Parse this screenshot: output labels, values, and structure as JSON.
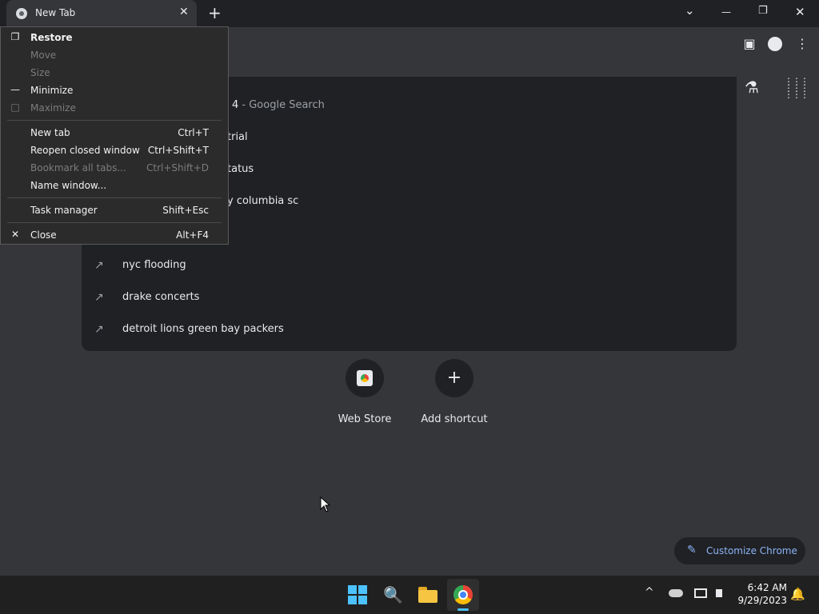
{
  "browser": {
    "tab_title": "New Tab",
    "tab_close": "✕",
    "new_tab": "+",
    "window_buttons": {
      "tab_search": "⌄",
      "minimize": "—",
      "restore": "❐",
      "close": "✕"
    }
  },
  "toolbar": {
    "side_panel": "▣",
    "menu": "⋮"
  },
  "page_icons": {
    "labs": "⚗",
    "apps": "⋮⋮⋮"
  },
  "suggestions": [
    {
      "icon": "trending-icon",
      "visible_text": "4",
      "suffix": " - Google Search"
    },
    {
      "icon": "trending-icon",
      "visible_text": "trial",
      "suffix": ""
    },
    {
      "icon": "trending-icon",
      "visible_text": "tatus",
      "suffix": ""
    },
    {
      "icon": "trending-icon",
      "visible_text": "y columbia sc",
      "suffix": ""
    },
    {
      "icon": "trending-icon",
      "visible_text": "",
      "suffix": ""
    },
    {
      "icon": "trending-icon",
      "visible_text": "nyc flooding",
      "suffix": ""
    },
    {
      "icon": "trending-icon",
      "visible_text": "drake concerts",
      "suffix": ""
    },
    {
      "icon": "trending-icon",
      "visible_text": "detroit lions green bay packers",
      "suffix": ""
    }
  ],
  "trend_glyph": "↗",
  "shortcuts": [
    {
      "label": "Web Store"
    },
    {
      "label": "Add shortcut",
      "glyph": "+"
    }
  ],
  "customize": {
    "label": "Customize Chrome",
    "glyph": "✎"
  },
  "system_menu": {
    "restore": {
      "label": "Restore",
      "icon": "❐"
    },
    "move": {
      "label": "Move"
    },
    "size": {
      "label": "Size"
    },
    "minimize": {
      "label": "Minimize",
      "icon": "—"
    },
    "maximize": {
      "label": "Maximize",
      "icon": "□"
    },
    "new_tab": {
      "label": "New tab",
      "shortcut": "Ctrl+T"
    },
    "reopen": {
      "label": "Reopen closed window",
      "shortcut": "Ctrl+Shift+T"
    },
    "bookmark_all": {
      "label": "Bookmark all tabs...",
      "shortcut": "Ctrl+Shift+D"
    },
    "name_window": {
      "label": "Name window..."
    },
    "task_manager": {
      "label": "Task manager",
      "shortcut": "Shift+Esc"
    },
    "close": {
      "label": "Close",
      "shortcut": "Alt+F4",
      "icon": "✕"
    }
  },
  "taskbar": {
    "search_glyph": "🔍",
    "tray_chevron": "^",
    "time": "6:42 AM",
    "date": "9/29/2023",
    "bell": "🔔"
  }
}
